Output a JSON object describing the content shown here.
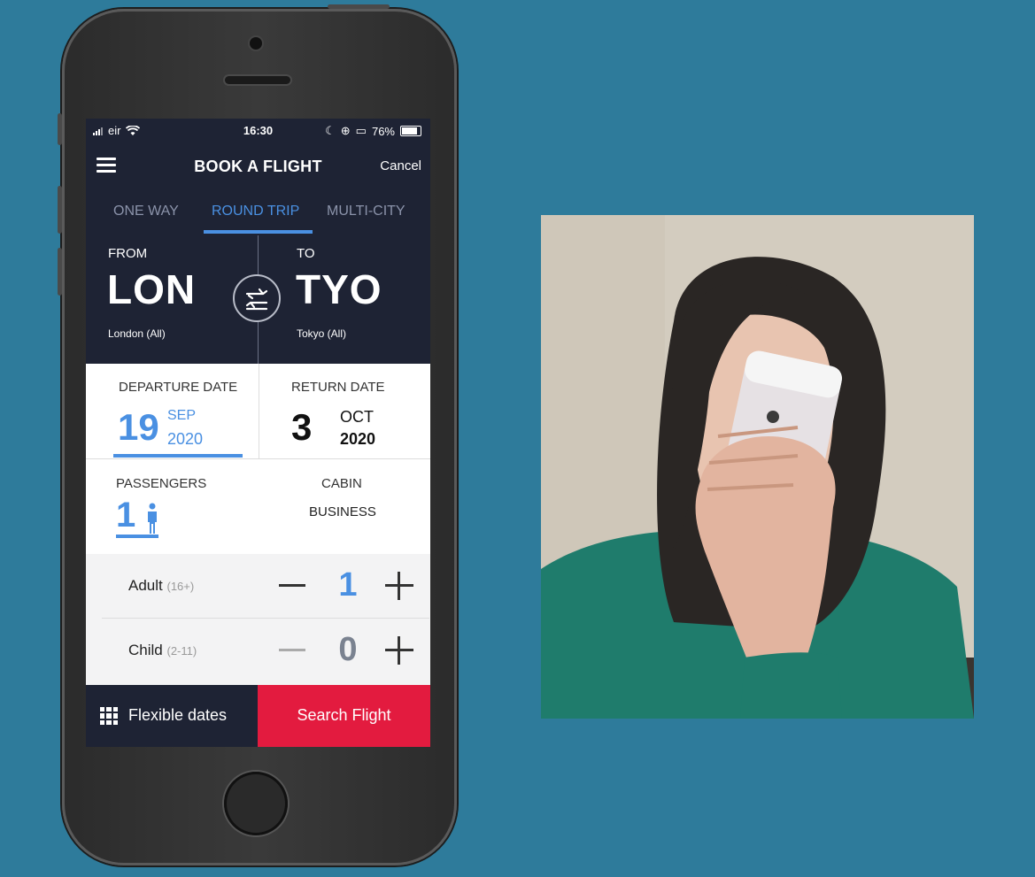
{
  "status_bar": {
    "carrier": "eir",
    "time": "16:30",
    "battery": "76%"
  },
  "header": {
    "title": "BOOK A FLIGHT",
    "cancel_label": "Cancel"
  },
  "tabs": [
    {
      "label": "ONE WAY",
      "active": false
    },
    {
      "label": "ROUND TRIP",
      "active": true
    },
    {
      "label": "MULTI-CITY",
      "active": false
    }
  ],
  "route": {
    "from_label": "FROM",
    "from_code": "LON",
    "from_city": "London (All)",
    "to_label": "TO",
    "to_code": "TYO",
    "to_city": "Tokyo (All)"
  },
  "dates": {
    "departure_label": "DEPARTURE DATE",
    "departure_day": "19",
    "departure_month": "SEP",
    "departure_year": "2020",
    "return_label": "RETURN DATE",
    "return_day": "3",
    "return_month": "OCT",
    "return_year": "2020"
  },
  "passengers": {
    "label": "PASSENGERS",
    "count": "1",
    "cabin_label": "CABIN",
    "cabin_value": "BUSINESS"
  },
  "counters": [
    {
      "name": "Adult",
      "range": "(16+)",
      "value": "1"
    },
    {
      "name": "Child",
      "range": "(2-11)",
      "value": "0"
    }
  ],
  "footer": {
    "flexible_label": "Flexible dates",
    "search_label": "Search Flight"
  },
  "colors": {
    "accent": "#4a90e2",
    "dark": "#1e2334",
    "cta": "#e31b3f",
    "background": "#2e7b9b"
  }
}
